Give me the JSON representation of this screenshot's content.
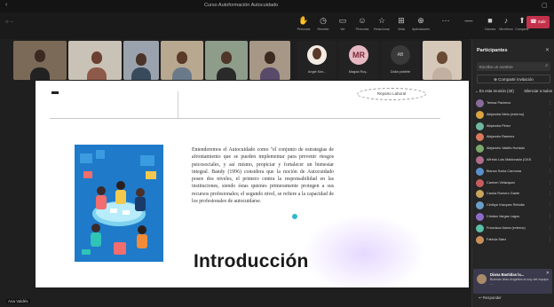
{
  "window": {
    "title": "Curso Autoformación Autocuidado"
  },
  "toolbar": {
    "items": [
      {
        "icon": "hand-icon",
        "label": "Personas"
      },
      {
        "icon": "chat-icon",
        "label": "Reunión"
      },
      {
        "icon": "view-icon",
        "label": "Ver"
      },
      {
        "icon": "people-icon",
        "label": "Personas"
      },
      {
        "icon": "react-icon",
        "label": "Reaccionar"
      },
      {
        "icon": "apps-icon",
        "label": "Vista"
      },
      {
        "icon": "more-icon",
        "label": "Aplicaciones"
      },
      {
        "icon": "camera-icon",
        "label": "Cámara"
      },
      {
        "icon": "mic-icon",
        "label": "Micrófono"
      },
      {
        "icon": "share-icon",
        "label": "Compartir"
      }
    ],
    "leave_label": "Salir"
  },
  "video_strip": {
    "audio_tiles": [
      {
        "name": "Angie Mor...",
        "initials": ""
      },
      {
        "name": "Magda Ruy...",
        "initials": "MR"
      },
      {
        "name": "Dalia poblete",
        "initials": "AB"
      }
    ]
  },
  "slide": {
    "label": "Reparto Laboral",
    "body": "Entenderemos el Autocuidado como \"el conjunto de estrategias de afrontamiento que se pueden implementar para prevenir riesgos psicosociales, y así mismo, propiciar y fortalecer un bienestar integral. Bandy (1996) considera que la noción de Autocuidado posee dos niveles, el primero centra la responsabilidad en las instituciones, siendo éstas quienes primeramente protegen a sus recursos profesionales; el segundo nivel, se refiere a la capacidad de los profesionales de autocuidarse.",
    "heading": "Introducción"
  },
  "presenter": {
    "name": "Ana Valdés"
  },
  "participants_panel": {
    "title": "Participantes",
    "search_placeholder": "Escribe un nombre",
    "share_label": "Compartir invitación",
    "section_label": "En esta reunión (40)",
    "mute_all_label": "Silenciar a todos",
    "participants": [
      {
        "name": "Teresa Pacheco",
        "color": "#8b6b9b"
      },
      {
        "name": "Alejandra Nieto (externo)",
        "color": "#d9a441"
      },
      {
        "name": "Alejandra Pérez",
        "color": "#6fb7a3"
      },
      {
        "name": "Alejandro Ramírez",
        "color": "#d97a5c"
      },
      {
        "name": "Alejandro Valdés Hurtado",
        "color": "#7da86b"
      },
      {
        "name": "Alfredo Luis Maldonado (OAS",
        "color": "#b06d8d"
      },
      {
        "name": "Blanca Sonia Carmona",
        "color": "#5b8fc9"
      },
      {
        "name": "Carmen Velázquez",
        "color": "#c75c5c"
      },
      {
        "name": "Carola Romero Gaete",
        "color": "#c9a65b"
      },
      {
        "name": "Cinthya Vázquez Rebolla",
        "color": "#6b9ec9"
      },
      {
        "name": "Cristian Vargas Lagos",
        "color": "#8f6bc9"
      },
      {
        "name": "Francisca Ibarra (externo)",
        "color": "#5bbfa7"
      },
      {
        "name": "Fabiola Sáez",
        "color": "#c98f5b"
      }
    ]
  },
  "notification": {
    "name": "Diana Bastidas la...",
    "message": "Buenos días Angélica si soy del equipo ..."
  },
  "reply_label": "Responder",
  "colors": {
    "leave": "#c4314b",
    "panel_bg": "#262626",
    "app_bg": "#1f1f1f",
    "accent_dot": "#33b8c9"
  }
}
